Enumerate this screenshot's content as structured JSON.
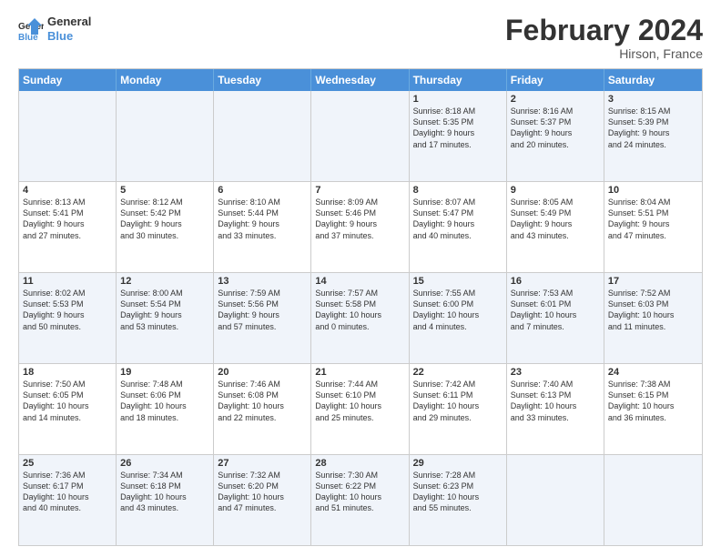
{
  "logo": {
    "text_general": "General",
    "text_blue": "Blue"
  },
  "header": {
    "month_title": "February 2024",
    "location": "Hirson, France"
  },
  "weekdays": [
    "Sunday",
    "Monday",
    "Tuesday",
    "Wednesday",
    "Thursday",
    "Friday",
    "Saturday"
  ],
  "rows": [
    [
      {
        "day": "",
        "empty": true
      },
      {
        "day": "",
        "empty": true
      },
      {
        "day": "",
        "empty": true
      },
      {
        "day": "",
        "empty": true
      },
      {
        "day": "1",
        "lines": [
          "Sunrise: 8:18 AM",
          "Sunset: 5:35 PM",
          "Daylight: 9 hours",
          "and 17 minutes."
        ]
      },
      {
        "day": "2",
        "lines": [
          "Sunrise: 8:16 AM",
          "Sunset: 5:37 PM",
          "Daylight: 9 hours",
          "and 20 minutes."
        ]
      },
      {
        "day": "3",
        "lines": [
          "Sunrise: 8:15 AM",
          "Sunset: 5:39 PM",
          "Daylight: 9 hours",
          "and 24 minutes."
        ]
      }
    ],
    [
      {
        "day": "4",
        "lines": [
          "Sunrise: 8:13 AM",
          "Sunset: 5:41 PM",
          "Daylight: 9 hours",
          "and 27 minutes."
        ]
      },
      {
        "day": "5",
        "lines": [
          "Sunrise: 8:12 AM",
          "Sunset: 5:42 PM",
          "Daylight: 9 hours",
          "and 30 minutes."
        ]
      },
      {
        "day": "6",
        "lines": [
          "Sunrise: 8:10 AM",
          "Sunset: 5:44 PM",
          "Daylight: 9 hours",
          "and 33 minutes."
        ]
      },
      {
        "day": "7",
        "lines": [
          "Sunrise: 8:09 AM",
          "Sunset: 5:46 PM",
          "Daylight: 9 hours",
          "and 37 minutes."
        ]
      },
      {
        "day": "8",
        "lines": [
          "Sunrise: 8:07 AM",
          "Sunset: 5:47 PM",
          "Daylight: 9 hours",
          "and 40 minutes."
        ]
      },
      {
        "day": "9",
        "lines": [
          "Sunrise: 8:05 AM",
          "Sunset: 5:49 PM",
          "Daylight: 9 hours",
          "and 43 minutes."
        ]
      },
      {
        "day": "10",
        "lines": [
          "Sunrise: 8:04 AM",
          "Sunset: 5:51 PM",
          "Daylight: 9 hours",
          "and 47 minutes."
        ]
      }
    ],
    [
      {
        "day": "11",
        "lines": [
          "Sunrise: 8:02 AM",
          "Sunset: 5:53 PM",
          "Daylight: 9 hours",
          "and 50 minutes."
        ]
      },
      {
        "day": "12",
        "lines": [
          "Sunrise: 8:00 AM",
          "Sunset: 5:54 PM",
          "Daylight: 9 hours",
          "and 53 minutes."
        ]
      },
      {
        "day": "13",
        "lines": [
          "Sunrise: 7:59 AM",
          "Sunset: 5:56 PM",
          "Daylight: 9 hours",
          "and 57 minutes."
        ]
      },
      {
        "day": "14",
        "lines": [
          "Sunrise: 7:57 AM",
          "Sunset: 5:58 PM",
          "Daylight: 10 hours",
          "and 0 minutes."
        ]
      },
      {
        "day": "15",
        "lines": [
          "Sunrise: 7:55 AM",
          "Sunset: 6:00 PM",
          "Daylight: 10 hours",
          "and 4 minutes."
        ]
      },
      {
        "day": "16",
        "lines": [
          "Sunrise: 7:53 AM",
          "Sunset: 6:01 PM",
          "Daylight: 10 hours",
          "and 7 minutes."
        ]
      },
      {
        "day": "17",
        "lines": [
          "Sunrise: 7:52 AM",
          "Sunset: 6:03 PM",
          "Daylight: 10 hours",
          "and 11 minutes."
        ]
      }
    ],
    [
      {
        "day": "18",
        "lines": [
          "Sunrise: 7:50 AM",
          "Sunset: 6:05 PM",
          "Daylight: 10 hours",
          "and 14 minutes."
        ]
      },
      {
        "day": "19",
        "lines": [
          "Sunrise: 7:48 AM",
          "Sunset: 6:06 PM",
          "Daylight: 10 hours",
          "and 18 minutes."
        ]
      },
      {
        "day": "20",
        "lines": [
          "Sunrise: 7:46 AM",
          "Sunset: 6:08 PM",
          "Daylight: 10 hours",
          "and 22 minutes."
        ]
      },
      {
        "day": "21",
        "lines": [
          "Sunrise: 7:44 AM",
          "Sunset: 6:10 PM",
          "Daylight: 10 hours",
          "and 25 minutes."
        ]
      },
      {
        "day": "22",
        "lines": [
          "Sunrise: 7:42 AM",
          "Sunset: 6:11 PM",
          "Daylight: 10 hours",
          "and 29 minutes."
        ]
      },
      {
        "day": "23",
        "lines": [
          "Sunrise: 7:40 AM",
          "Sunset: 6:13 PM",
          "Daylight: 10 hours",
          "and 33 minutes."
        ]
      },
      {
        "day": "24",
        "lines": [
          "Sunrise: 7:38 AM",
          "Sunset: 6:15 PM",
          "Daylight: 10 hours",
          "and 36 minutes."
        ]
      }
    ],
    [
      {
        "day": "25",
        "lines": [
          "Sunrise: 7:36 AM",
          "Sunset: 6:17 PM",
          "Daylight: 10 hours",
          "and 40 minutes."
        ]
      },
      {
        "day": "26",
        "lines": [
          "Sunrise: 7:34 AM",
          "Sunset: 6:18 PM",
          "Daylight: 10 hours",
          "and 43 minutes."
        ]
      },
      {
        "day": "27",
        "lines": [
          "Sunrise: 7:32 AM",
          "Sunset: 6:20 PM",
          "Daylight: 10 hours",
          "and 47 minutes."
        ]
      },
      {
        "day": "28",
        "lines": [
          "Sunrise: 7:30 AM",
          "Sunset: 6:22 PM",
          "Daylight: 10 hours",
          "and 51 minutes."
        ]
      },
      {
        "day": "29",
        "lines": [
          "Sunrise: 7:28 AM",
          "Sunset: 6:23 PM",
          "Daylight: 10 hours",
          "and 55 minutes."
        ]
      },
      {
        "day": "",
        "empty": true
      },
      {
        "day": "",
        "empty": true
      }
    ]
  ],
  "alt_rows": [
    0,
    2,
    4
  ]
}
